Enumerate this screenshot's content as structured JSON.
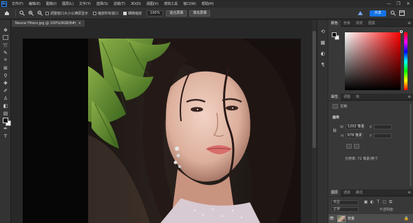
{
  "app": {
    "logo": "Ps"
  },
  "menubar": {
    "items": [
      "文件(F)",
      "编辑(E)",
      "图像(I)",
      "图层(L)",
      "文字(Y)",
      "选择(S)",
      "滤镜(T)",
      "3D(D)",
      "视图(V)",
      "增效工具",
      "窗口(W)",
      "帮助(H)"
    ],
    "window_controls": [
      "—",
      "❐",
      "✕"
    ]
  },
  "options": {
    "checkbox_resize_windows": "调整窗口大小以满屏显示",
    "checkbox_zoom_all": "缩放所有窗口",
    "checkbox_scrubby_zoom": "细微缩放",
    "zoom_value": "100%",
    "fit_screen": "适合屏幕",
    "fill_screen": "填充屏幕",
    "share_label": "共享"
  },
  "document": {
    "tab_title": "Neural Filters.jpg @ 100%(RGB/8#)",
    "tab_close": "×"
  },
  "panels": {
    "color_tabs": [
      "颜色",
      "色板",
      "渐变",
      "图案"
    ],
    "properties_tabs": [
      "属性",
      "调整",
      "库"
    ],
    "properties_doc_label": "文档",
    "canvas_section": "画布",
    "width_label": "W",
    "width_value": "1202 像素",
    "height_label": "H",
    "height_value": "676 像素",
    "x_label": "X",
    "y_label": "Y",
    "resolution": "分辨率: 72 像素/英寸",
    "layers_tabs": [
      "图层",
      "通道",
      "路径"
    ],
    "layer_search_placeholder": "类型",
    "blend_mode": "正常",
    "opacity_label": "不透明度:",
    "opacity_value": "100%",
    "fill_label": "填充:",
    "fill_value": "100%",
    "layer_name": "背景"
  }
}
